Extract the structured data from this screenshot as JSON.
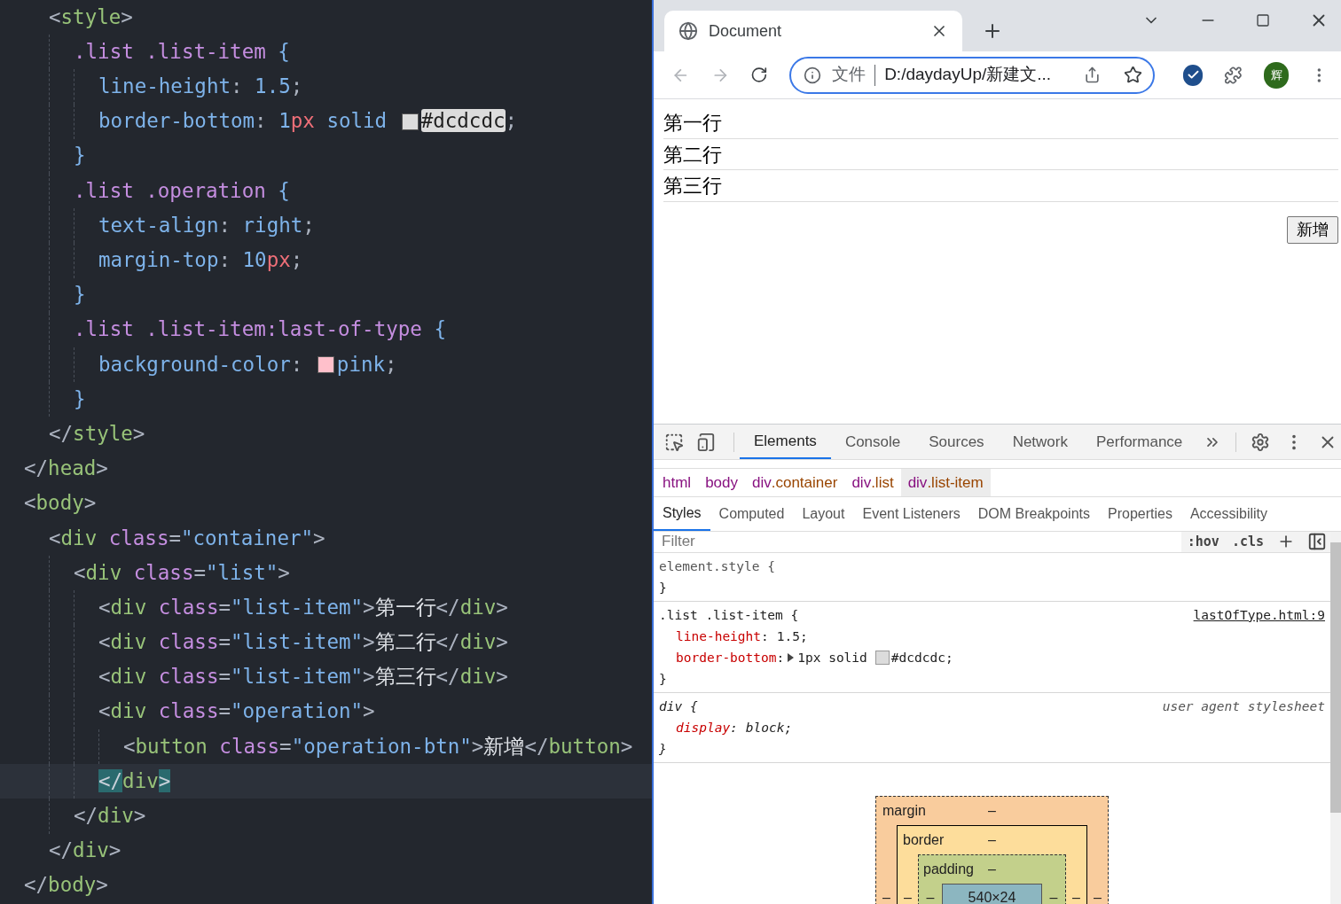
{
  "code": {
    "lines": [
      {
        "children": [
          {
            "current": false,
            "tokens": [
              {
                "kind": "punct",
                "text": "<"
              },
              {
                "kind": "tag",
                "text": "style"
              },
              {
                "kind": "punct",
                "text": ">"
              }
            ],
            "children": [
              {
                "current": false,
                "tokens": [
                  {
                    "kind": "selector",
                    "text": ".list .list-item "
                  },
                  {
                    "kind": "brace",
                    "text": "{"
                  }
                ],
                "children": [
                  {
                    "current": false,
                    "tokens": [
                      {
                        "kind": "property",
                        "text": "line-height"
                      },
                      {
                        "kind": "punct",
                        "text": ": "
                      },
                      {
                        "kind": "number",
                        "text": "1.5"
                      },
                      {
                        "kind": "punct",
                        "text": ";"
                      }
                    ]
                  },
                  {
                    "current": false,
                    "tokens": [
                      {
                        "kind": "property",
                        "text": "border-bottom"
                      },
                      {
                        "kind": "punct",
                        "text": ": "
                      },
                      {
                        "kind": "number",
                        "text": "1"
                      },
                      {
                        "kind": "unit",
                        "text": "px"
                      },
                      {
                        "kind": "value",
                        "text": " solid "
                      },
                      {
                        "kind": "swatch",
                        "color": "#dcdcdc"
                      },
                      {
                        "kind": "selected-text",
                        "text": "#dcdcdc"
                      },
                      {
                        "kind": "punct",
                        "text": ";"
                      }
                    ]
                  }
                ]
              },
              {
                "current": false,
                "tokens": [
                  {
                    "kind": "brace",
                    "text": "}"
                  }
                ]
              },
              {
                "current": false,
                "tokens": [
                  {
                    "kind": "selector",
                    "text": ".list .operation "
                  },
                  {
                    "kind": "brace",
                    "text": "{"
                  }
                ],
                "children": [
                  {
                    "current": false,
                    "tokens": [
                      {
                        "kind": "property",
                        "text": "text-align"
                      },
                      {
                        "kind": "punct",
                        "text": ": "
                      },
                      {
                        "kind": "value",
                        "text": "right"
                      },
                      {
                        "kind": "punct",
                        "text": ";"
                      }
                    ]
                  },
                  {
                    "current": false,
                    "tokens": [
                      {
                        "kind": "property",
                        "text": "margin-top"
                      },
                      {
                        "kind": "punct",
                        "text": ": "
                      },
                      {
                        "kind": "number",
                        "text": "10"
                      },
                      {
                        "kind": "unit",
                        "text": "px"
                      },
                      {
                        "kind": "punct",
                        "text": ";"
                      }
                    ]
                  }
                ]
              },
              {
                "current": false,
                "tokens": [
                  {
                    "kind": "brace",
                    "text": "}"
                  }
                ]
              },
              {
                "current": false,
                "tokens": [
                  {
                    "kind": "selector",
                    "text": ".list .list-item:last-of-type "
                  },
                  {
                    "kind": "brace",
                    "text": "{"
                  }
                ],
                "children": [
                  {
                    "current": false,
                    "tokens": [
                      {
                        "kind": "property",
                        "text": "background-color"
                      },
                      {
                        "kind": "punct",
                        "text": ": "
                      },
                      {
                        "kind": "swatch",
                        "color": "#ffc0cb"
                      },
                      {
                        "kind": "value",
                        "text": "pink"
                      },
                      {
                        "kind": "punct",
                        "text": ";"
                      }
                    ]
                  }
                ]
              },
              {
                "current": false,
                "tokens": [
                  {
                    "kind": "brace",
                    "text": "}"
                  }
                ]
              }
            ]
          },
          {
            "current": false,
            "tokens": [
              {
                "kind": "punct",
                "text": "</"
              },
              {
                "kind": "tag",
                "text": "style"
              },
              {
                "kind": "punct",
                "text": ">"
              }
            ]
          }
        ]
      },
      {
        "current": false,
        "tokens": [
          {
            "kind": "punct",
            "text": "</"
          },
          {
            "kind": "tag",
            "text": "head"
          },
          {
            "kind": "punct",
            "text": ">"
          }
        ]
      },
      {
        "current": false,
        "tokens": [
          {
            "kind": "punct",
            "text": "<"
          },
          {
            "kind": "tag",
            "text": "body"
          },
          {
            "kind": "punct",
            "text": ">"
          }
        ],
        "children": [
          {
            "current": false,
            "tokens": [
              {
                "kind": "punct",
                "text": "<"
              },
              {
                "kind": "tag",
                "text": "div"
              },
              {
                "kind": "attr",
                "text": " class"
              },
              {
                "kind": "punct",
                "text": "="
              },
              {
                "kind": "string",
                "text": "\"container\""
              },
              {
                "kind": "punct",
                "text": ">"
              }
            ],
            "children": [
              {
                "current": false,
                "tokens": [
                  {
                    "kind": "punct",
                    "text": "<"
                  },
                  {
                    "kind": "tag",
                    "text": "div"
                  },
                  {
                    "kind": "attr",
                    "text": " class"
                  },
                  {
                    "kind": "punct",
                    "text": "="
                  },
                  {
                    "kind": "string",
                    "text": "\"list\""
                  },
                  {
                    "kind": "punct",
                    "text": ">"
                  }
                ],
                "children": [
                  {
                    "current": false,
                    "tokens": [
                      {
                        "kind": "punct",
                        "text": "<"
                      },
                      {
                        "kind": "tag",
                        "text": "div"
                      },
                      {
                        "kind": "attr",
                        "text": " class"
                      },
                      {
                        "kind": "punct",
                        "text": "="
                      },
                      {
                        "kind": "string",
                        "text": "\"list-item\""
                      },
                      {
                        "kind": "punct",
                        "text": ">"
                      },
                      {
                        "kind": "text",
                        "text": "第一行"
                      },
                      {
                        "kind": "punct",
                        "text": "</"
                      },
                      {
                        "kind": "tag",
                        "text": "div"
                      },
                      {
                        "kind": "punct",
                        "text": ">"
                      }
                    ]
                  },
                  {
                    "current": false,
                    "tokens": [
                      {
                        "kind": "punct",
                        "text": "<"
                      },
                      {
                        "kind": "tag",
                        "text": "div"
                      },
                      {
                        "kind": "attr",
                        "text": " class"
                      },
                      {
                        "kind": "punct",
                        "text": "="
                      },
                      {
                        "kind": "string",
                        "text": "\"list-item\""
                      },
                      {
                        "kind": "punct",
                        "text": ">"
                      },
                      {
                        "kind": "text",
                        "text": "第二行"
                      },
                      {
                        "kind": "punct",
                        "text": "</"
                      },
                      {
                        "kind": "tag",
                        "text": "div"
                      },
                      {
                        "kind": "punct",
                        "text": ">"
                      }
                    ]
                  },
                  {
                    "current": false,
                    "tokens": [
                      {
                        "kind": "punct",
                        "text": "<"
                      },
                      {
                        "kind": "tag",
                        "text": "div"
                      },
                      {
                        "kind": "attr",
                        "text": " class"
                      },
                      {
                        "kind": "punct",
                        "text": "="
                      },
                      {
                        "kind": "string",
                        "text": "\"list-item\""
                      },
                      {
                        "kind": "punct",
                        "text": ">"
                      },
                      {
                        "kind": "text",
                        "text": "第三行"
                      },
                      {
                        "kind": "punct",
                        "text": "</"
                      },
                      {
                        "kind": "tag",
                        "text": "div"
                      },
                      {
                        "kind": "punct",
                        "text": ">"
                      }
                    ]
                  },
                  {
                    "current": false,
                    "tokens": [
                      {
                        "kind": "punct",
                        "text": "<"
                      },
                      {
                        "kind": "tag",
                        "text": "div"
                      },
                      {
                        "kind": "attr",
                        "text": " class"
                      },
                      {
                        "kind": "punct",
                        "text": "="
                      },
                      {
                        "kind": "string",
                        "text": "\"operation\""
                      },
                      {
                        "kind": "punct",
                        "text": ">"
                      }
                    ],
                    "children": [
                      {
                        "current": false,
                        "tokens": [
                          {
                            "kind": "punct",
                            "text": "<"
                          },
                          {
                            "kind": "tag",
                            "text": "button"
                          },
                          {
                            "kind": "attr",
                            "text": " class"
                          },
                          {
                            "kind": "punct",
                            "text": "="
                          },
                          {
                            "kind": "string",
                            "text": "\"operation-btn\""
                          },
                          {
                            "kind": "punct",
                            "text": ">"
                          },
                          {
                            "kind": "text",
                            "text": "新增"
                          },
                          {
                            "kind": "punct",
                            "text": "</"
                          },
                          {
                            "kind": "tag",
                            "text": "button"
                          },
                          {
                            "kind": "punct",
                            "text": ">"
                          }
                        ]
                      }
                    ]
                  },
                  {
                    "current": true,
                    "tokens": [
                      {
                        "kind": "match-bracket",
                        "text": "</"
                      },
                      {
                        "kind": "tag",
                        "text": "div"
                      },
                      {
                        "kind": "match-bracket",
                        "text": ">"
                      }
                    ]
                  }
                ]
              },
              {
                "current": false,
                "tokens": [
                  {
                    "kind": "punct",
                    "text": "</"
                  },
                  {
                    "kind": "tag",
                    "text": "div"
                  },
                  {
                    "kind": "punct",
                    "text": ">"
                  }
                ]
              }
            ]
          },
          {
            "current": false,
            "tokens": [
              {
                "kind": "punct",
                "text": "</"
              },
              {
                "kind": "tag",
                "text": "div"
              },
              {
                "kind": "punct",
                "text": ">"
              }
            ]
          }
        ]
      },
      {
        "current": false,
        "tokens": [
          {
            "kind": "punct",
            "text": "</"
          },
          {
            "kind": "tag",
            "text": "body"
          },
          {
            "kind": "punct",
            "text": ">"
          }
        ]
      }
    ]
  },
  "browser": {
    "tab": {
      "title": "Document"
    },
    "nav": {
      "back_disabled": true,
      "forward_disabled": true
    },
    "omnibox": {
      "security_label": "文件",
      "url": "D:/daydayUp/新建文..."
    },
    "avatar": "辉"
  },
  "page": {
    "rows": [
      "第一行",
      "第二行",
      "第三行"
    ],
    "button": "新增"
  },
  "devtools": {
    "tabs": [
      {
        "label": "Elements",
        "selected": true
      },
      {
        "label": "Console",
        "selected": false
      },
      {
        "label": "Sources",
        "selected": false
      },
      {
        "label": "Network",
        "selected": false
      },
      {
        "label": "Performance",
        "selected": false
      }
    ],
    "breadcrumbs": [
      {
        "tag": "html",
        "selected": false
      },
      {
        "tag": "body",
        "selected": false
      },
      {
        "tag": "div",
        "class_name": ".container",
        "selected": false
      },
      {
        "tag": "div",
        "class_name": ".list",
        "selected": false
      },
      {
        "tag": "div",
        "class_name": ".list-item",
        "selected": true
      }
    ],
    "style_tabs": [
      {
        "label": "Styles",
        "selected": true
      },
      {
        "label": "Computed",
        "selected": false
      },
      {
        "label": "Layout",
        "selected": false
      },
      {
        "label": "Event Listeners",
        "selected": false
      },
      {
        "label": "DOM Breakpoints",
        "selected": false
      },
      {
        "label": "Properties",
        "selected": false
      },
      {
        "label": "Accessibility",
        "selected": false
      }
    ],
    "filter": {
      "placeholder": "Filter"
    },
    "filter_buttons": [
      ":hov",
      ".cls"
    ],
    "rules": [
      {
        "kind": "inline",
        "selector": "element.style {",
        "close": "}"
      },
      {
        "kind": "author",
        "selector": ".list .list-item {",
        "source": "lastOfType.html:9",
        "close": "}",
        "declarations": [
          {
            "property": "line-height",
            "colon": ":",
            "expandable": false,
            "value": "1.5;"
          },
          {
            "property": "border-bottom",
            "colon": ":",
            "expandable": true,
            "value": "1px solid",
            "color": "#dcdcdc",
            "color_text": "#dcdcdc;"
          }
        ]
      },
      {
        "kind": "user-agent",
        "selector": "div {",
        "source": "user agent stylesheet",
        "close": "}",
        "declarations": [
          {
            "property": "display",
            "colon": ":",
            "expandable": false,
            "value": "block;"
          }
        ]
      }
    ],
    "box_model": {
      "margin": {
        "label": "margin",
        "top": "–",
        "left": "–",
        "right": "–"
      },
      "border": {
        "label": "border",
        "top": "–",
        "left": "–",
        "right": "–"
      },
      "padding": {
        "label": "padding",
        "top": "–",
        "left": "–",
        "right": "–"
      },
      "content": "540×24"
    }
  }
}
